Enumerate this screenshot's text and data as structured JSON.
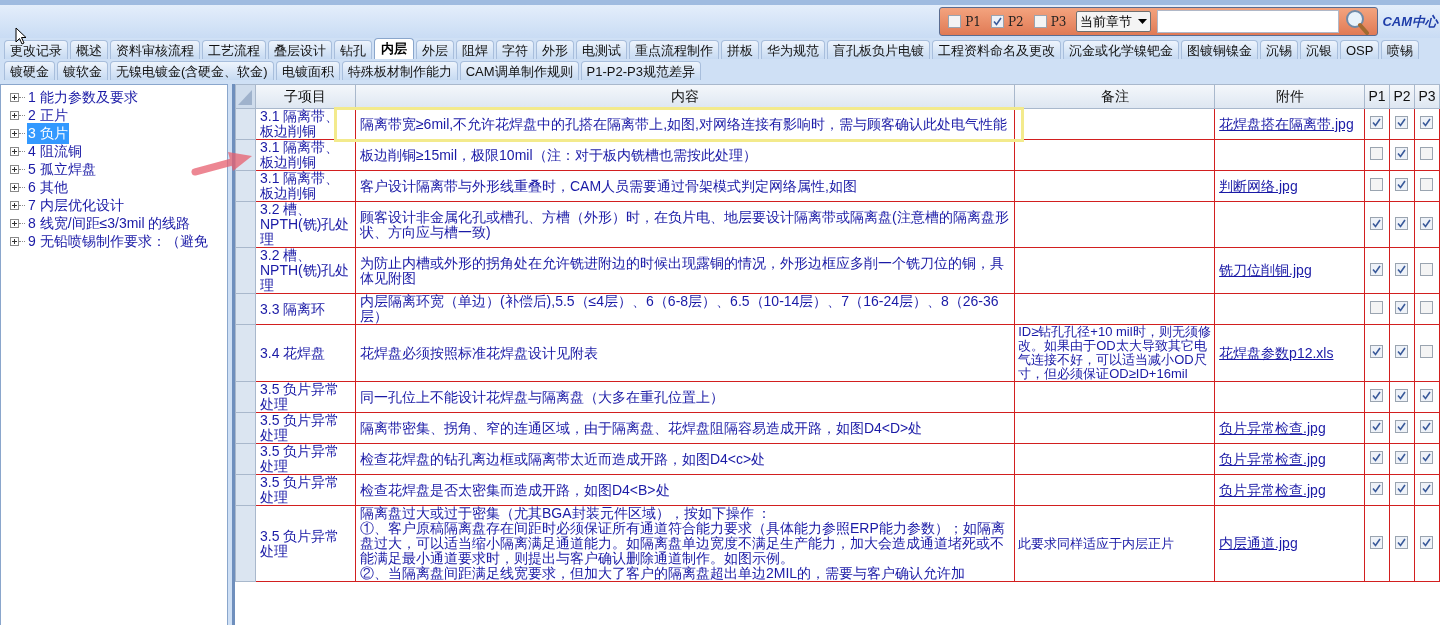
{
  "toolbar": {
    "filters": [
      {
        "label": "P1",
        "checked": false
      },
      {
        "label": "P2",
        "checked": true
      },
      {
        "label": "P3",
        "checked": false
      }
    ],
    "scope_select": {
      "value": "当前章节"
    },
    "logo": "CAM中心"
  },
  "tab_rows": [
    {
      "tabs": [
        {
          "label": "更改记录",
          "selected": false
        },
        {
          "label": "概述",
          "selected": false
        },
        {
          "label": "资料审核流程",
          "selected": false
        },
        {
          "label": "工艺流程",
          "selected": false
        },
        {
          "label": "叠层设计",
          "selected": false
        },
        {
          "label": "钻孔",
          "selected": false
        },
        {
          "label": "内层",
          "selected": true
        },
        {
          "label": "外层",
          "selected": false
        },
        {
          "label": "阻焊",
          "selected": false
        },
        {
          "label": "字符",
          "selected": false
        },
        {
          "label": "外形",
          "selected": false
        },
        {
          "label": "电测试",
          "selected": false
        },
        {
          "label": "重点流程制作",
          "selected": false
        },
        {
          "label": "拼板",
          "selected": false
        },
        {
          "label": "华为规范",
          "selected": false
        },
        {
          "label": "盲孔板负片电镀",
          "selected": false
        },
        {
          "label": "工程资料命名及更改",
          "selected": false
        },
        {
          "label": "沉金或化学镍钯金",
          "selected": false
        },
        {
          "label": "图镀铜镍金",
          "selected": false
        },
        {
          "label": "沉锡",
          "selected": false
        },
        {
          "label": "沉银",
          "selected": false
        },
        {
          "label": "OSP",
          "selected": false
        },
        {
          "label": "喷锡",
          "selected": false
        }
      ]
    },
    {
      "tabs": [
        {
          "label": "镀硬金",
          "selected": false
        },
        {
          "label": "镀软金",
          "selected": false
        },
        {
          "label": "无镍电镀金(含硬金、软金)",
          "selected": false
        },
        {
          "label": "电镀面积",
          "selected": false
        },
        {
          "label": "特殊板材制作能力",
          "selected": false
        },
        {
          "label": "CAM调单制作规则",
          "selected": false
        },
        {
          "label": "P1-P2-P3规范差异",
          "selected": false
        }
      ]
    }
  ],
  "sidebar": {
    "items": [
      {
        "label": "1 能力参数及要求",
        "expanded": false,
        "selected": false
      },
      {
        "label": "2 正片",
        "expanded": false,
        "selected": false
      },
      {
        "label": "3 负片",
        "expanded": false,
        "selected": true
      },
      {
        "label": "4 阻流铜",
        "expanded": false,
        "selected": false
      },
      {
        "label": "5 孤立焊盘",
        "expanded": false,
        "selected": false
      },
      {
        "label": "6 其他",
        "expanded": false,
        "selected": false
      },
      {
        "label": "7 内层优化设计",
        "expanded": false,
        "selected": false
      },
      {
        "label": "8 线宽/间距≤3/3mil 的线路",
        "expanded": false,
        "selected": false
      },
      {
        "label": "9 无铅喷锡制作要求：（避免",
        "expanded": false,
        "selected": false
      }
    ]
  },
  "table": {
    "columns": [
      "子项目",
      "内容",
      "备注",
      "附件",
      "P1",
      "P2",
      "P3"
    ],
    "rows": [
      {
        "sub": "3.1 隔离带、板边削铜",
        "content": "隔离带宽≥6mil,不允许花焊盘中的孔搭在隔离带上,如图,对网络连接有影响时，需与顾客确认此处电气性能",
        "remark": "",
        "attachment": "花焊盘搭在隔离带.jpg",
        "p1": true,
        "p2": true,
        "p3": true
      },
      {
        "sub": "3.1 隔离带、板边削铜",
        "content": "板边削铜≥15mil，极限10mil（注：对于板内铣槽也需按此处理）",
        "remark": "",
        "attachment": "",
        "p1": false,
        "p2": true,
        "p3": false
      },
      {
        "sub": "3.1 隔离带、板边削铜",
        "content": "客户设计隔离带与外形线重叠时，CAM人员需要通过骨架模式判定网络属性,如图",
        "remark": "",
        "attachment": "判断网络.jpg",
        "p1": false,
        "p2": true,
        "p3": false
      },
      {
        "sub": "3.2 槽、NPTH(铣)孔处理",
        "content": "顾客设计非金属化孔或槽孔、方槽（外形）时，在负片电、地层要设计隔离带或隔离盘(注意槽的隔离盘形状、方向应与槽一致)",
        "remark": "",
        "attachment": "",
        "p1": true,
        "p2": true,
        "p3": true
      },
      {
        "sub": "3.2 槽、NPTH(铣)孔处理",
        "content": "为防止内槽或外形的拐角处在允许铣进附边的时候出现露铜的情况，外形边框应多削一个铣刀位的铜，具体见附图",
        "remark": "",
        "attachment": "铣刀位削铜.jpg",
        "p1": true,
        "p2": true,
        "p3": false
      },
      {
        "sub": "3.3 隔离环",
        "content": "内层隔离环宽（单边）(补偿后),5.5（≤4层）、6（6-8层）、6.5（10-14层）、7（16-24层）、8（26-36层）",
        "remark": "",
        "attachment": "",
        "p1": false,
        "p2": true,
        "p3": false
      },
      {
        "sub": "3.4 花焊盘",
        "content": "花焊盘必须按照标准花焊盘设计见附表",
        "remark": "ID≥钻孔孔径+10 mil时，则无须修改。如果由于OD太大导致其它电气连接不好，可以适当减小OD尺寸，但必须保证OD≥ID+16mil",
        "attachment": "花焊盘参数p12.xls",
        "p1": true,
        "p2": true,
        "p3": false
      },
      {
        "sub": "3.5 负片异常处理",
        "content": "同一孔位上不能设计花焊盘与隔离盘（大多在重孔位置上）",
        "remark": "",
        "attachment": "",
        "p1": true,
        "p2": true,
        "p3": true
      },
      {
        "sub": "3.5 负片异常处理",
        "content": "隔离带密集、拐角、窄的连通区域，由于隔离盘、花焊盘阻隔容易造成开路，如图D4<D>处",
        "remark": "",
        "attachment": "负片异常检查.jpg",
        "p1": true,
        "p2": true,
        "p3": true
      },
      {
        "sub": "3.5 负片异常处理",
        "content": "检查花焊盘的钻孔离边框或隔离带太近而造成开路，如图D4<c>处",
        "remark": "",
        "attachment": "负片异常检查.jpg",
        "p1": true,
        "p2": true,
        "p3": true
      },
      {
        "sub": "3.5 负片异常处理",
        "content": "检查花焊盘是否太密集而造成开路，如图D4<B>处",
        "remark": "",
        "attachment": "负片异常检查.jpg",
        "p1": true,
        "p2": true,
        "p3": true
      },
      {
        "sub": "3.5 负片异常处理",
        "content": "隔离盘过大或过于密集（尤其BGA封装元件区域），按如下操作 ：\n①、客户原稿隔离盘存在间距时必须保证所有通道符合能力要求（具体能力参照ERP能力参数）；如隔离盘过大，可以适当缩小隔离满足通道能力。如隔离盘单边宽度不满足生产能力，加大会造成通道堵死或不能满足最小通道要求时，则提出与客户确认删除通道制作。如图示例。\n②、当隔离盘间距满足线宽要求，但加大了客户的隔离盘超出单边2MIL的，需要与客户确认允许加",
        "remark": "此要求同样适应于内层正片",
        "attachment": "内层通道.jpg",
        "p1": true,
        "p2": true,
        "p3": true
      }
    ]
  }
}
